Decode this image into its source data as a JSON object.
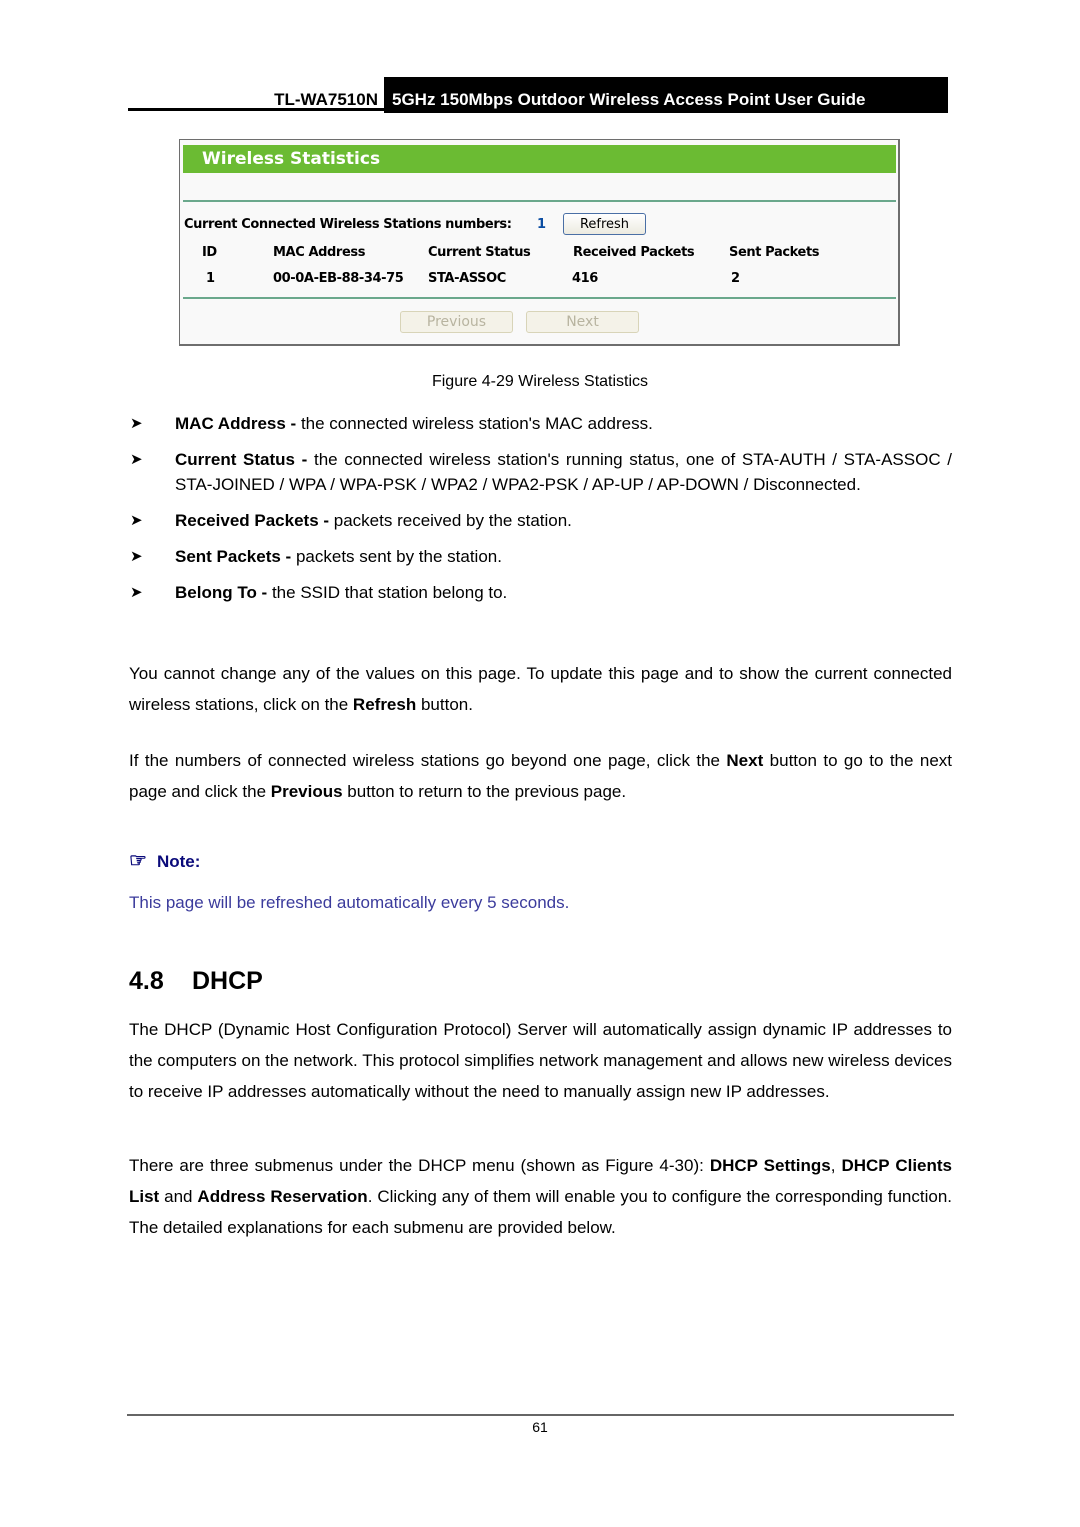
{
  "header": {
    "model": "TL-WA7510N",
    "title": "5GHz 150Mbps Outdoor Wireless Access Point User Guide"
  },
  "screenshot": {
    "title": "Wireless Statistics",
    "stations_label": "Current Connected Wireless Stations numbers:",
    "stations_count": "1",
    "refresh_label": "Refresh",
    "columns": [
      "ID",
      "MAC Address",
      "Current Status",
      "Received Packets",
      "Sent Packets"
    ],
    "rows": [
      [
        "1",
        "00-0A-EB-88-34-75",
        "STA-ASSOC",
        "416",
        "2"
      ]
    ],
    "previous_label": "Previous",
    "next_label": "Next"
  },
  "caption": "Figure 4-29 Wireless Statistics",
  "bullets": [
    {
      "term": "MAC Address -",
      "text": " the connected wireless station's MAC address."
    },
    {
      "term": "Current Status -",
      "text": " the connected wireless station's running status, one of STA-AUTH / STA-ASSOC / STA-JOINED / WPA / WPA-PSK / WPA2 / WPA2-PSK / AP-UP / AP-DOWN / Disconnected."
    },
    {
      "term": "Received Packets -",
      "text": " packets received by the station."
    },
    {
      "term": "Sent Packets -",
      "text": " packets sent by the station."
    },
    {
      "term": "Belong To -",
      "text": " the SSID that station belong to."
    }
  ],
  "paragraph1": {
    "a": "You cannot change any of the values on this page. To update this page and to show the current connected wireless stations, click on the ",
    "b": "Refresh",
    "c": " button."
  },
  "paragraph2": {
    "a": "If the numbers of connected wireless stations go beyond one page, click the ",
    "b": "Next",
    "c": " button to go to the next page and click the ",
    "d": "Previous",
    "e": " button to return to the previous page."
  },
  "note": {
    "icon": "pointing-hand-icon",
    "label": "Note:",
    "text": "This page will be refreshed automatically every 5 seconds."
  },
  "section": {
    "number": "4.8",
    "title": "DHCP"
  },
  "paragraph3": "The DHCP (Dynamic Host Configuration Protocol) Server will automatically assign dynamic IP addresses to the computers on the network. This protocol simplifies network management and allows new wireless devices to receive IP addresses automatically without the need to manually assign new IP addresses.",
  "paragraph4": {
    "a": "There are three submenus under the DHCP menu (shown as Figure 4-30): ",
    "b": "DHCP Settings",
    "c": ", ",
    "d": "DHCP Clients List",
    "e": " and ",
    "f": "Address Reservation",
    "g": ". Clicking any of them will enable you to configure the corresponding function. The detailed explanations for each submenu are provided below."
  },
  "page_number": "61"
}
